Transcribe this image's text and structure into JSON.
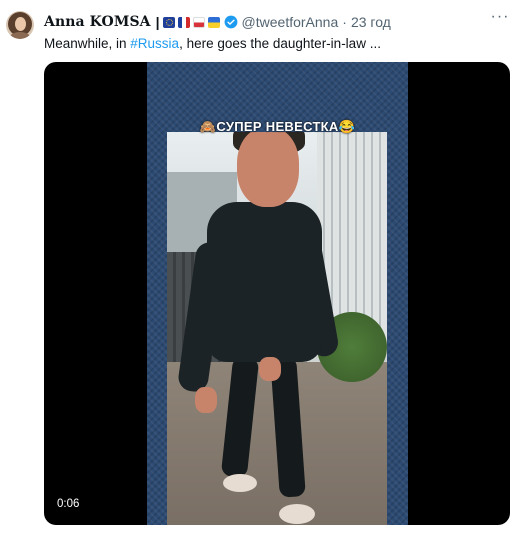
{
  "tweet": {
    "author_name": "Anna KOMSA",
    "separator": "|",
    "flags": [
      "eu-flag-icon",
      "france-flag-icon",
      "poland-flag-icon",
      "ukraine-flag-icon"
    ],
    "verified_icon": "verified-badge-icon",
    "handle": "@tweetforAnna",
    "dot": "·",
    "time": "23 год",
    "more_icon": "more-options-icon",
    "more_label": "···",
    "text_before": "Meanwhile, in ",
    "hashtag": "#Russia",
    "text_after": ", here goes the daughter-in-law ..."
  },
  "media": {
    "video_caption": "🙈СУПЕР НЕВЕСТКА😂",
    "duration": "0:06"
  },
  "colors": {
    "link": "#1d9bf0",
    "secondary": "#536471",
    "verified": "#1d9bf0"
  }
}
